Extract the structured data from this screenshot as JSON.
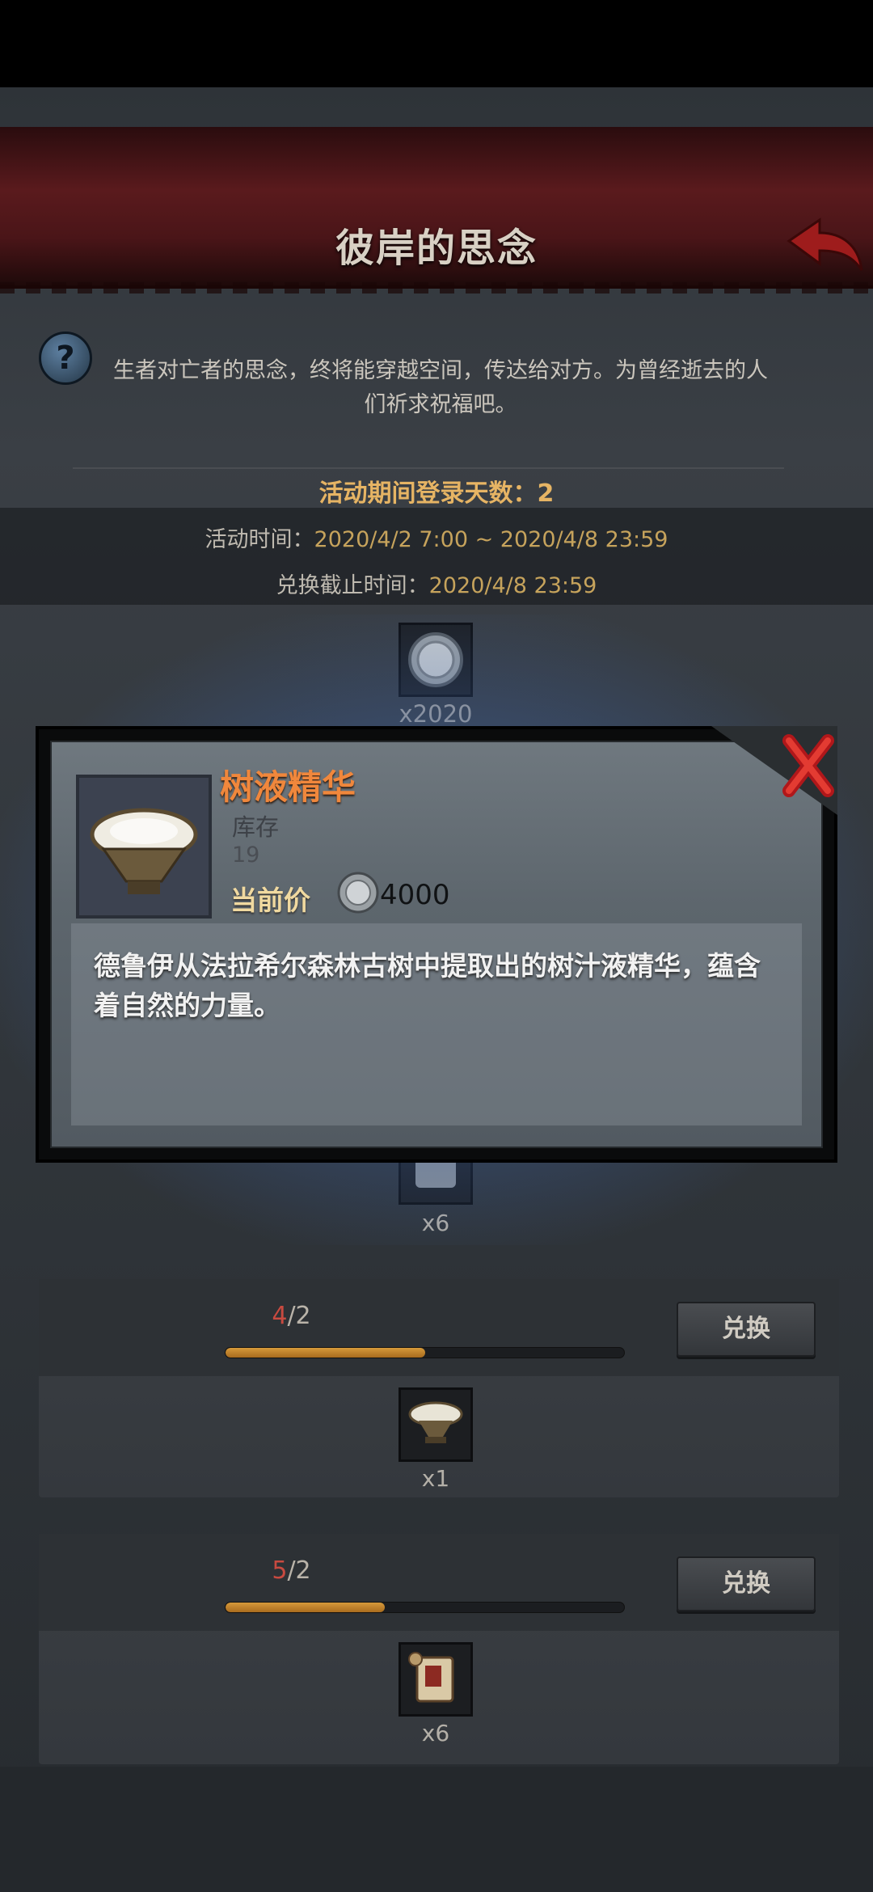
{
  "page": {
    "title": "彼岸的思念",
    "description": "生者对亡者的思念，终将能穿越空间，传达给对方。为曾经逝去的人们祈求祝福吧。"
  },
  "event": {
    "login_days_text": "活动期间登录天数：2",
    "time_label": "活动时间：",
    "time_value": "2020/4/2 7:00 ~ 2020/4/8 23:59",
    "deadline_label": "兑换截止时间：",
    "deadline_value": "2020/4/8 23:59"
  },
  "top_reward": {
    "icon": "silver-coin-icon",
    "quantity": "x2020"
  },
  "hidden_reward": {
    "icon": "scroll-icon",
    "quantity": "x6"
  },
  "cards": [
    {
      "current": "4",
      "separator": "/",
      "required": "2",
      "progress": 0.5,
      "button": "兑换",
      "item_icon": "sap-bowl-icon",
      "quantity": "x1"
    },
    {
      "current": "5",
      "separator": "/",
      "required": "2",
      "progress": 0.4,
      "button": "兑换",
      "item_icon": "scroll-icon",
      "quantity": "x6"
    }
  ],
  "popup": {
    "item_name": "树液精华",
    "stock_label": "库存",
    "stock_value": "19",
    "price_label": "当前价",
    "price_value": "4000",
    "description": "德鲁伊从法拉希尔森林古树中提取出的树汁液精华，蕴含着自然的力量。"
  },
  "colors": {
    "accent_orange": "#f0873c",
    "gold": "#e6b464",
    "count_red": "#c84a40",
    "banner_red": "#5a1a1d"
  }
}
